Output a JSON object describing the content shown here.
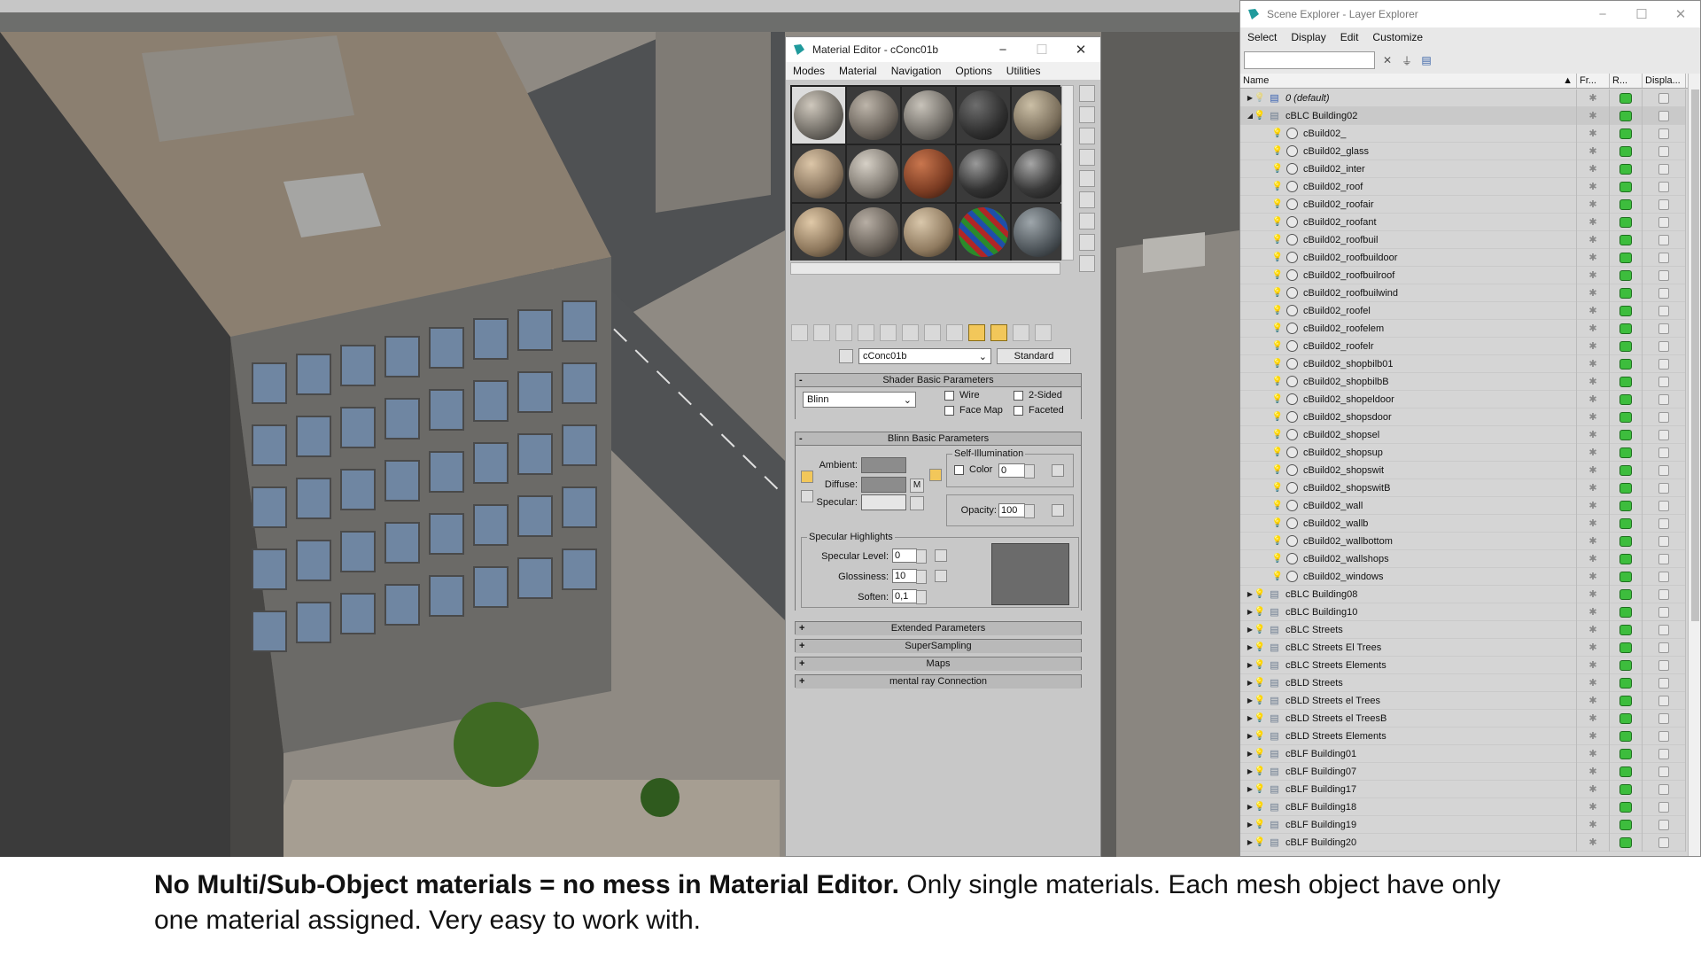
{
  "material_editor": {
    "title": "Material Editor - cConc01b",
    "menus": [
      "Modes",
      "Material",
      "Navigation",
      "Options",
      "Utilities"
    ],
    "material_name": "cConc01b",
    "material_type": "Standard",
    "shader_rollout": {
      "title": "Shader Basic Parameters",
      "shader": "Blinn",
      "wire": "Wire",
      "two_sided": "2-Sided",
      "face_map": "Face Map",
      "faceted": "Faceted"
    },
    "blinn_rollout": {
      "title": "Blinn Basic Parameters",
      "ambient": "Ambient:",
      "diffuse": "Diffuse:",
      "specular": "Specular:",
      "map_btn": "M",
      "self_illum_group": "Self-Illumination",
      "color_label": "Color",
      "color_value": "0",
      "opacity_label": "Opacity:",
      "opacity_value": "100",
      "spec_group": "Specular Highlights",
      "spec_level_label": "Specular Level:",
      "spec_level": "0",
      "gloss_label": "Glossiness:",
      "gloss": "10",
      "soften_label": "Soften:",
      "soften": "0,1"
    },
    "collapsed_rollouts": [
      "Extended Parameters",
      "SuperSampling",
      "Maps",
      "mental ray Connection"
    ]
  },
  "scene_explorer": {
    "title": "Scene Explorer - Layer Explorer",
    "menus": [
      "Select",
      "Display",
      "Edit",
      "Customize"
    ],
    "columns": [
      "Name",
      "Fr...",
      "R...",
      "Displa..."
    ],
    "rows": [
      {
        "label": "0 (default)",
        "kind": "layer",
        "italic": true,
        "indent": 0,
        "expand": "right"
      },
      {
        "label": "cBLC Building02",
        "kind": "layer",
        "indent": 0,
        "expand": "down"
      },
      {
        "label": "cBuild02_",
        "kind": "object",
        "indent": 1
      },
      {
        "label": "cBuild02_glass",
        "kind": "object",
        "indent": 1
      },
      {
        "label": "cBuild02_inter",
        "kind": "object",
        "indent": 1
      },
      {
        "label": "cBuild02_roof",
        "kind": "object",
        "indent": 1
      },
      {
        "label": "cBuild02_roofair",
        "kind": "object",
        "indent": 1
      },
      {
        "label": "cBuild02_roofant",
        "kind": "object",
        "indent": 1
      },
      {
        "label": "cBuild02_roofbuil",
        "kind": "object",
        "indent": 1
      },
      {
        "label": "cBuild02_roofbuildoor",
        "kind": "object",
        "indent": 1
      },
      {
        "label": "cBuild02_roofbuilroof",
        "kind": "object",
        "indent": 1
      },
      {
        "label": "cBuild02_roofbuilwind",
        "kind": "object",
        "indent": 1
      },
      {
        "label": "cBuild02_roofel",
        "kind": "object",
        "indent": 1
      },
      {
        "label": "cBuild02_roofelem",
        "kind": "object",
        "indent": 1
      },
      {
        "label": "cBuild02_roofelr",
        "kind": "object",
        "indent": 1
      },
      {
        "label": "cBuild02_shopbilb01",
        "kind": "object",
        "indent": 1
      },
      {
        "label": "cBuild02_shopbilbB",
        "kind": "object",
        "indent": 1
      },
      {
        "label": "cBuild02_shopeldoor",
        "kind": "object",
        "indent": 1
      },
      {
        "label": "cBuild02_shopsdoor",
        "kind": "object",
        "indent": 1
      },
      {
        "label": "cBuild02_shopsel",
        "kind": "object",
        "indent": 1
      },
      {
        "label": "cBuild02_shopsup",
        "kind": "object",
        "indent": 1
      },
      {
        "label": "cBuild02_shopswit",
        "kind": "object",
        "indent": 1
      },
      {
        "label": "cBuild02_shopswitB",
        "kind": "object",
        "indent": 1
      },
      {
        "label": "cBuild02_wall",
        "kind": "object",
        "indent": 1
      },
      {
        "label": "cBuild02_wallb",
        "kind": "object",
        "indent": 1
      },
      {
        "label": "cBuild02_wallbottom",
        "kind": "object",
        "indent": 1
      },
      {
        "label": "cBuild02_wallshops",
        "kind": "object",
        "indent": 1
      },
      {
        "label": "cBuild02_windows",
        "kind": "object",
        "indent": 1
      },
      {
        "label": "cBLC Building08",
        "kind": "layer",
        "indent": 0,
        "expand": "right"
      },
      {
        "label": "cBLC Building10",
        "kind": "layer",
        "indent": 0,
        "expand": "right"
      },
      {
        "label": "cBLC Streets",
        "kind": "layer",
        "indent": 0,
        "expand": "right"
      },
      {
        "label": "cBLC Streets El Trees",
        "kind": "layer",
        "indent": 0,
        "expand": "right"
      },
      {
        "label": "cBLC Streets Elements",
        "kind": "layer",
        "indent": 0,
        "expand": "right"
      },
      {
        "label": "cBLD Streets",
        "kind": "layer",
        "indent": 0,
        "expand": "right"
      },
      {
        "label": "cBLD Streets el Trees",
        "kind": "layer",
        "indent": 0,
        "expand": "right"
      },
      {
        "label": "cBLD Streets el TreesB",
        "kind": "layer",
        "indent": 0,
        "expand": "right"
      },
      {
        "label": "cBLD Streets Elements",
        "kind": "layer",
        "indent": 0,
        "expand": "right"
      },
      {
        "label": "cBLF Building01",
        "kind": "layer",
        "indent": 0,
        "expand": "right"
      },
      {
        "label": "cBLF Building07",
        "kind": "layer",
        "indent": 0,
        "expand": "right"
      },
      {
        "label": "cBLF Building17",
        "kind": "layer",
        "indent": 0,
        "expand": "right"
      },
      {
        "label": "cBLF Building18",
        "kind": "layer",
        "indent": 0,
        "expand": "right"
      },
      {
        "label": "cBLF Building19",
        "kind": "layer",
        "indent": 0,
        "expand": "right"
      },
      {
        "label": "cBLF Building20",
        "kind": "layer",
        "indent": 0,
        "expand": "right"
      }
    ]
  },
  "caption": {
    "bold": "No Multi/Sub-Object materials = no mess in Material Editor.",
    "normal": " Only single materials. Each mesh object have only one material assigned. Very easy to work with."
  }
}
